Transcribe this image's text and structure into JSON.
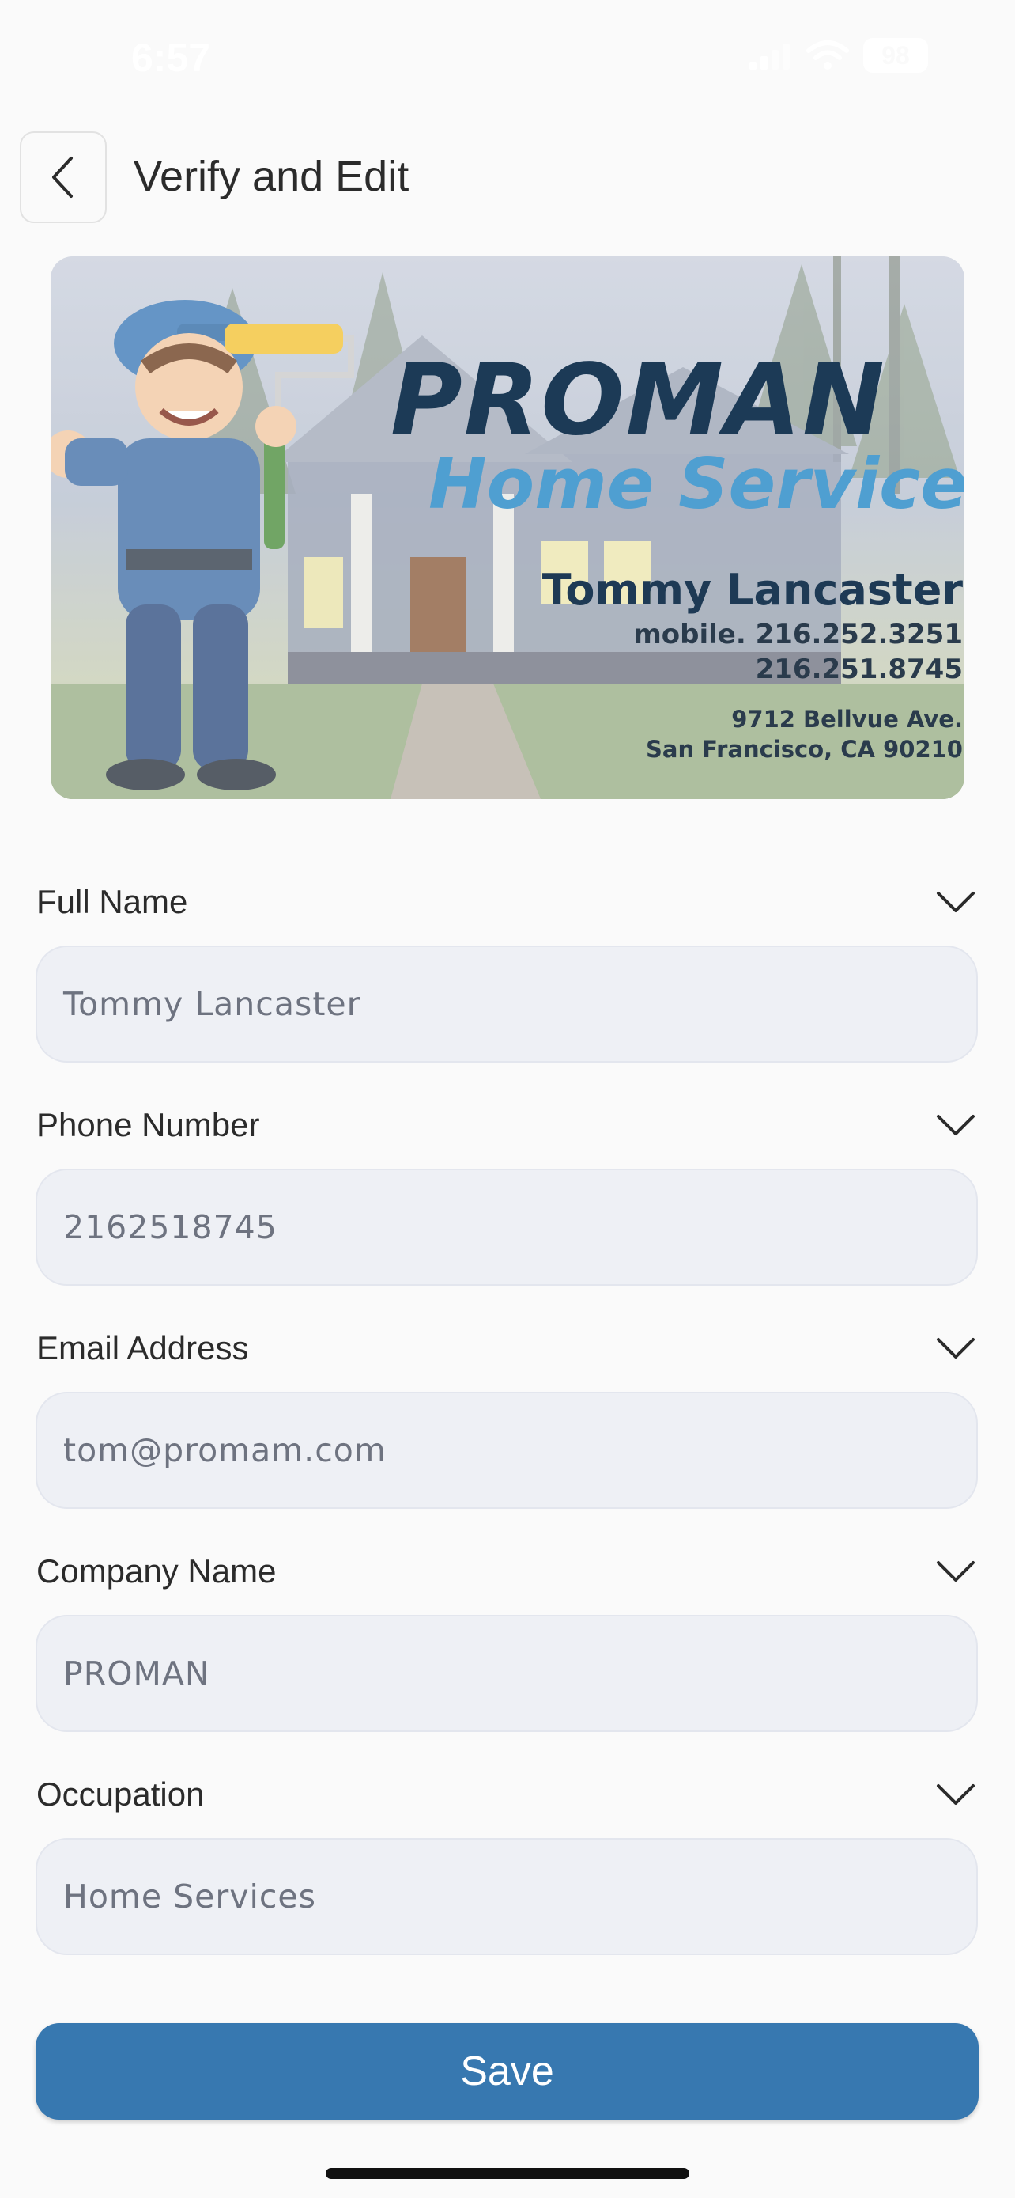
{
  "status_bar": {
    "time": "6:57",
    "battery": "98",
    "icons": [
      "signal-icon",
      "wifi-icon",
      "battery-icon"
    ]
  },
  "header": {
    "title": "Verify and Edit",
    "back_icon": "chevron-left-icon"
  },
  "card": {
    "brand": "PROMAN",
    "tagline": "Home Services",
    "name": "Tommy Lancaster",
    "mobile": "mobile. 216.252.3251",
    "phone": "216.251.8745",
    "address_line1": "9712 Bellvue Ave.",
    "address_line2": "San Francisco, CA 90210"
  },
  "form": {
    "fields": [
      {
        "label": "Full Name",
        "value": "Tommy Lancaster"
      },
      {
        "label": "Phone Number",
        "value": "2162518745"
      },
      {
        "label": "Email Address",
        "value": "tom@promam.com"
      },
      {
        "label": "Company Name",
        "value": "PROMAN"
      },
      {
        "label": "Occupation",
        "value": "Home Services"
      }
    ],
    "save_label": "Save"
  },
  "colors": {
    "accent": "#3778b0",
    "input_bg": "#eef0f5",
    "background": "#fafafa"
  }
}
